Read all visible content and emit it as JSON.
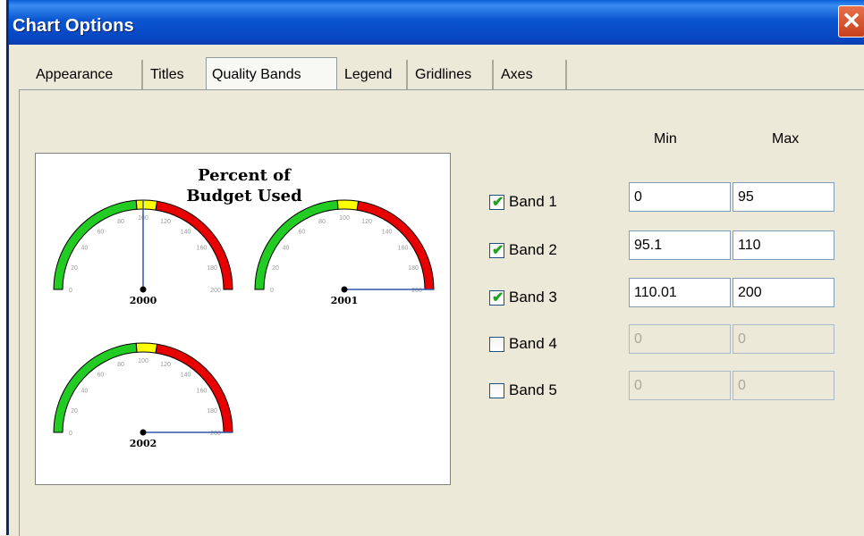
{
  "window": {
    "title": "Chart Options",
    "close_glyph": "✕"
  },
  "tabs": [
    {
      "label": "Appearance",
      "active": false
    },
    {
      "label": "Titles",
      "active": false
    },
    {
      "label": "Quality Bands",
      "active": true
    },
    {
      "label": "Legend",
      "active": false
    },
    {
      "label": "Gridlines",
      "active": false
    },
    {
      "label": "Axes",
      "active": false
    }
  ],
  "columns": {
    "min": "Min",
    "max": "Max"
  },
  "bands": [
    {
      "label": "Band 1",
      "checked": true,
      "min": "0",
      "max": "95"
    },
    {
      "label": "Band 2",
      "checked": true,
      "min": "95.1",
      "max": "110"
    },
    {
      "label": "Band 3",
      "checked": true,
      "min": "110.01",
      "max": "200"
    },
    {
      "label": "Band 4",
      "checked": false,
      "min": "0",
      "max": "0"
    },
    {
      "label": "Band 5",
      "checked": false,
      "min": "0",
      "max": "0"
    }
  ],
  "preview": {
    "title_line1": "Percent of",
    "title_line2": "Budget Used",
    "colors": {
      "green": "#22cc22",
      "yellow": "#ffff00",
      "red": "#e80000",
      "needle": "#3355aa"
    },
    "gauges": [
      {
        "label": "2000",
        "value": 100
      },
      {
        "label": "2001",
        "value": 200
      },
      {
        "label": "2002",
        "value": 200
      }
    ],
    "ticks": [
      "0",
      "20",
      "40",
      "60",
      "80",
      "100",
      "120",
      "140",
      "160",
      "180",
      "200"
    ]
  }
}
